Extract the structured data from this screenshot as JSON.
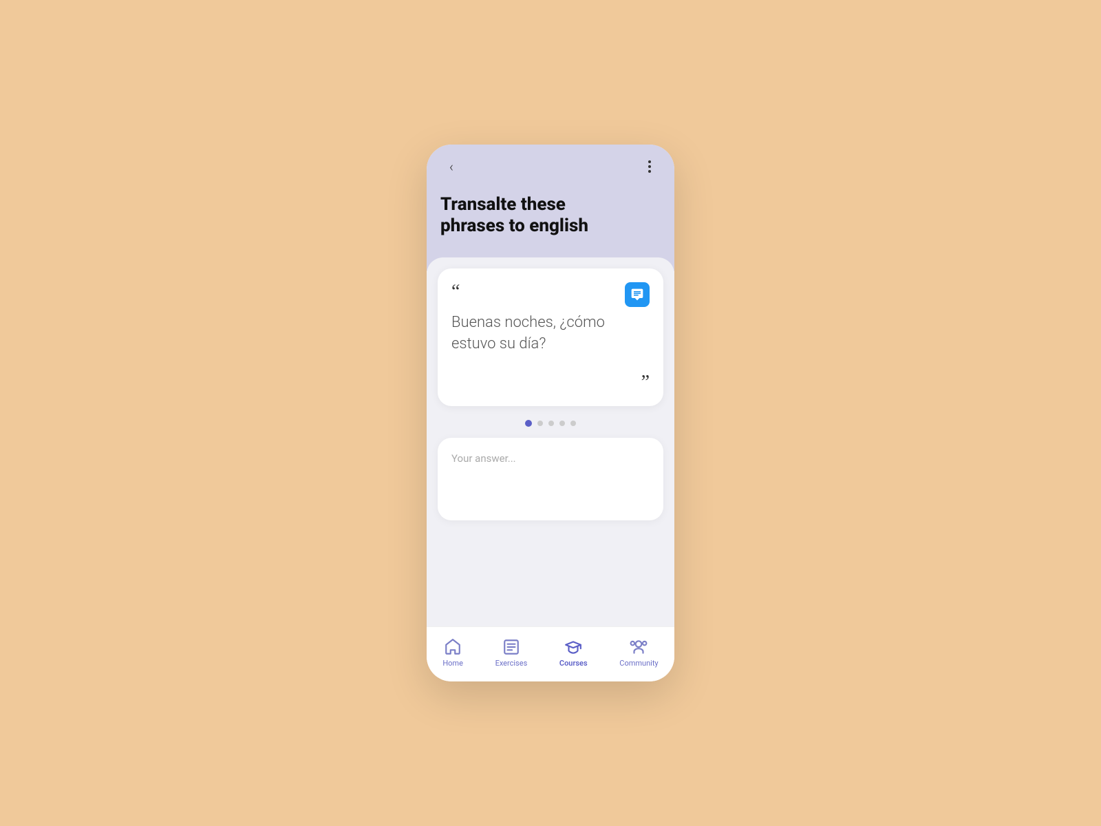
{
  "page": {
    "background_color": "#f0c99a"
  },
  "header": {
    "back_label": "<",
    "title_line1": "Transalte these",
    "title_line2": "phrases to english"
  },
  "card": {
    "phrase": "Buenas noches, ¿cómo estuvo su día?",
    "quote_open": "“",
    "quote_close": "”"
  },
  "pagination": {
    "total": 5,
    "active_index": 0
  },
  "answer_input": {
    "placeholder": "Your answer..."
  },
  "bottom_nav": {
    "items": [
      {
        "id": "home",
        "label": "Home",
        "active": false
      },
      {
        "id": "exercises",
        "label": "Exercises",
        "active": false
      },
      {
        "id": "courses",
        "label": "Courses",
        "active": true
      },
      {
        "id": "community",
        "label": "Community",
        "active": false
      }
    ]
  }
}
